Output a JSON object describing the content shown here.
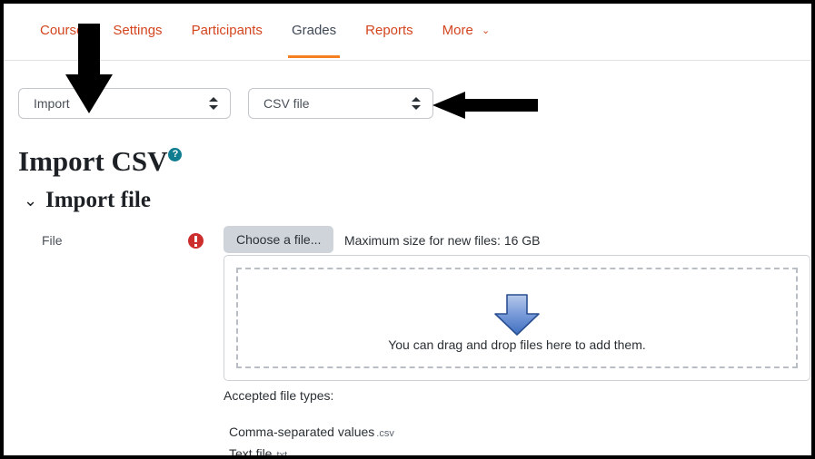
{
  "nav": {
    "items": [
      {
        "label": "Course",
        "active": false,
        "has_caret": false
      },
      {
        "label": "Settings",
        "active": false,
        "has_caret": false
      },
      {
        "label": "Participants",
        "active": false,
        "has_caret": false
      },
      {
        "label": "Grades",
        "active": true,
        "has_caret": false
      },
      {
        "label": "Reports",
        "active": false,
        "has_caret": false
      },
      {
        "label": "More",
        "active": false,
        "has_caret": true
      }
    ],
    "caret_glyph": "⌄",
    "active_underline_color": "#f48022",
    "link_color": "#d3451f",
    "active_color": "#3f4956"
  },
  "selects": {
    "mode": {
      "value": "Import",
      "name": "action-select"
    },
    "type": {
      "value": "CSV file",
      "name": "import-method-select"
    }
  },
  "page": {
    "title": "Import CSV",
    "help_icon_glyph": "?",
    "help_icon_color": "#0f7d8f",
    "section_chevron_glyph": "⌄",
    "section_title": "Import file"
  },
  "file_field": {
    "label": "File",
    "required_marker": "!",
    "required_color": "#cc2d2d",
    "choose_button": "Choose a file...",
    "max_size_text": "Maximum size for new files: 16 GB"
  },
  "dropzone": {
    "message": "You can drag and drop files here to add them.",
    "arrow_icon": "download-arrow-icon",
    "arrow_fill_top": "#9ab5e0",
    "arrow_fill_bottom": "#3f6fc0",
    "arrow_border": "#2a4f91"
  },
  "accepted": {
    "heading": "Accepted file types:",
    "types": [
      {
        "name": "Comma-separated values",
        "ext": ".csv"
      },
      {
        "name": "Text file",
        "ext": ".txt"
      }
    ]
  },
  "annotations": [
    {
      "name": "annotation-arrow-down",
      "points_to": "action-select",
      "color": "#000000"
    },
    {
      "name": "annotation-arrow-left",
      "points_to": "import-method-select",
      "color": "#000000"
    }
  ]
}
